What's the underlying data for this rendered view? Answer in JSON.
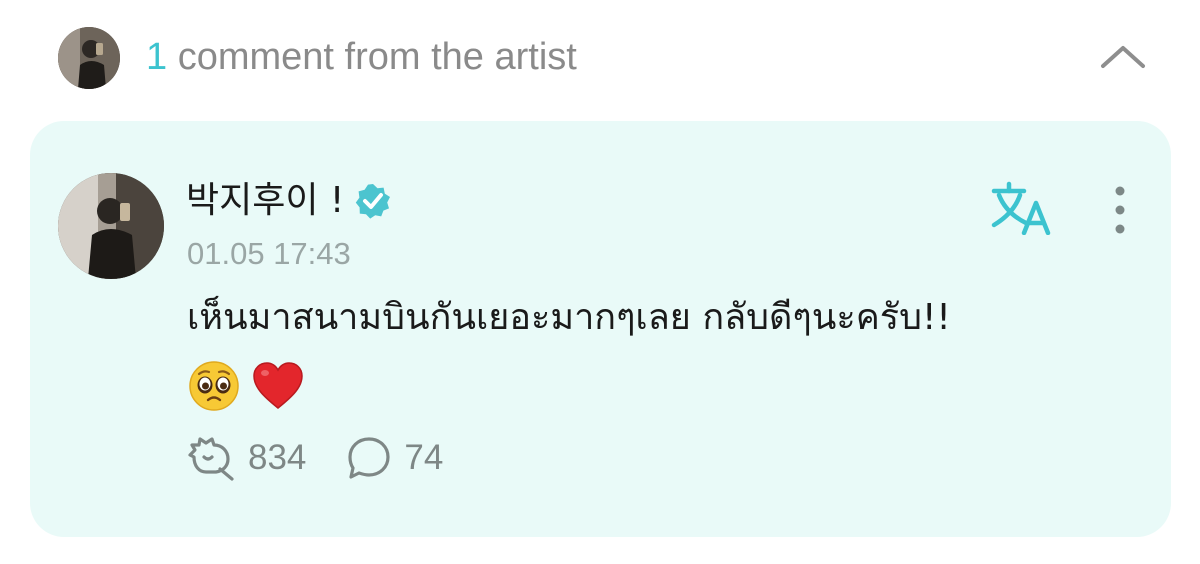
{
  "header": {
    "count": "1",
    "title_text": "comment from the artist",
    "collapse_icon": "chevron-up-icon"
  },
  "comment": {
    "author": "박지후이 !",
    "verified_icon": "verified-badge-icon",
    "timestamp": "01.05 17:43",
    "text": "เห็นมาสนามบินกันเยอะมากๆเลย กลับดีๆนะครับ!!",
    "emojis": [
      "pleading-face-emoji",
      "red-heart-emoji"
    ],
    "translate_icon": "translate-icon",
    "more_icon": "more-vertical-icon",
    "likes": "834",
    "replies": "74"
  },
  "colors": {
    "accent": "#3cc3cf",
    "card_background": "#e9faf8",
    "muted_text": "#8a8a8a"
  }
}
